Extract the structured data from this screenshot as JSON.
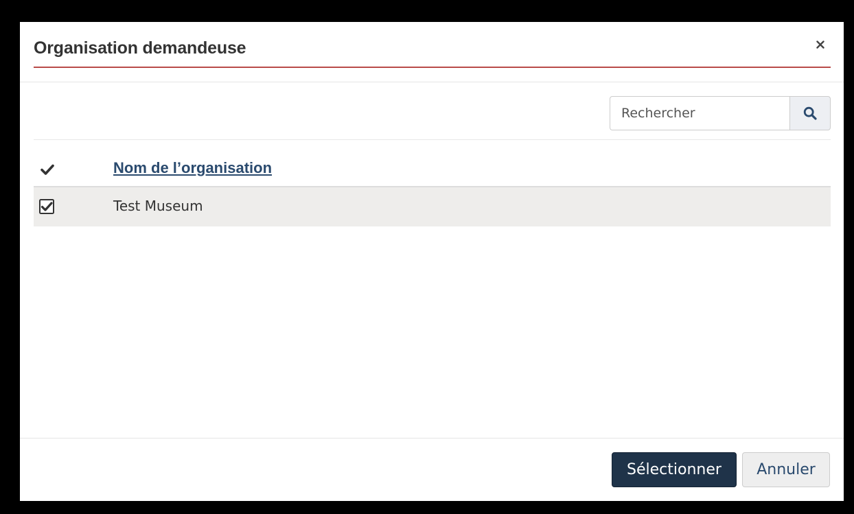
{
  "dialog": {
    "title": "Organisation demandeuse",
    "close_icon": "close-icon"
  },
  "search": {
    "placeholder": "Rechercher",
    "value": "",
    "icon": "search-icon"
  },
  "table": {
    "header_check_icon": "checkmark-icon",
    "columns": [
      "Nom de l’organisation"
    ],
    "rows": [
      {
        "selected": true,
        "name": "Test Museum"
      }
    ]
  },
  "footer": {
    "select_label": "Sélectionner",
    "cancel_label": "Annuler"
  },
  "colors": {
    "primary": "#1f3349",
    "accent_rule": "#b94a48",
    "link": "#2a4a6e",
    "selected_row_bg": "#eeedeb"
  }
}
